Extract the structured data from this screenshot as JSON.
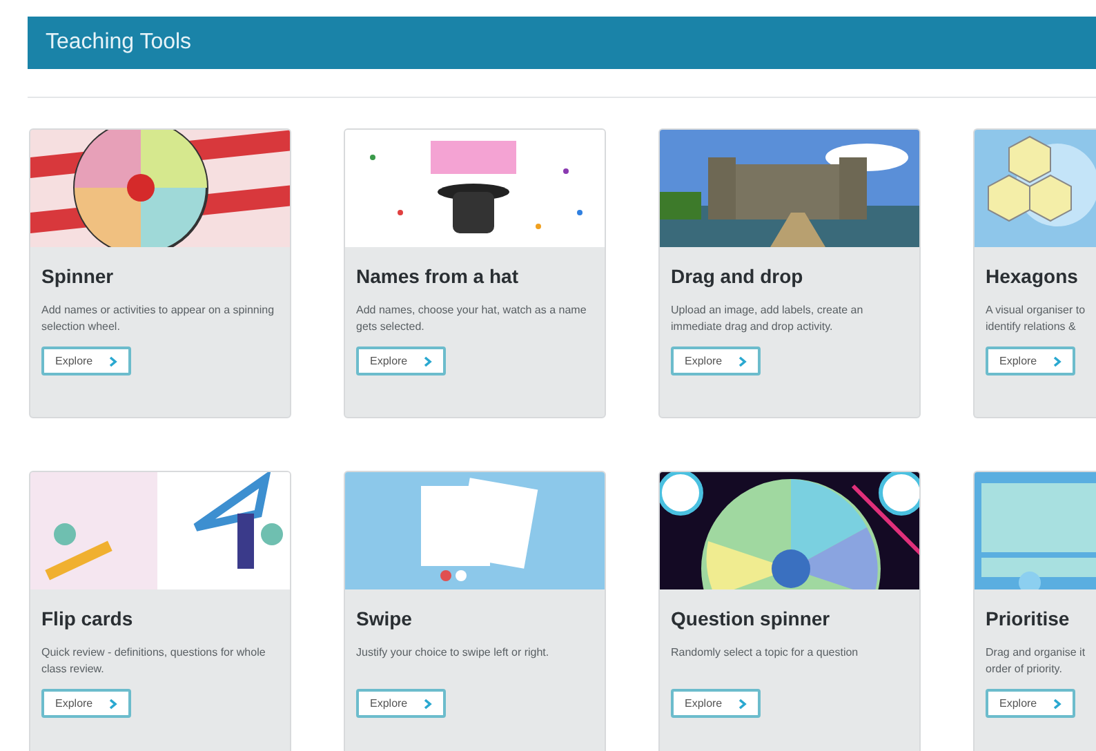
{
  "header": {
    "title": "Teaching Tools"
  },
  "tools": [
    {
      "title": "Spinner",
      "description": "Add names or activities to appear on a spinning selection wheel.",
      "button": "Explore"
    },
    {
      "title": "Names from a hat",
      "description": "Add names, choose your hat, watch as a name gets selected.",
      "button": "Explore"
    },
    {
      "title": "Drag and drop",
      "description": "Upload an image, add labels, create an immediate drag and drop activity.",
      "button": "Explore"
    },
    {
      "title": "Hexagons",
      "description": "A visual organiser to identify relations &",
      "button": "Explore"
    },
    {
      "title": "Flip cards",
      "description": "Quick review - definitions, questions for whole class review.",
      "button": "Explore"
    },
    {
      "title": "Swipe",
      "description": "Justify your choice to swipe left or right.",
      "button": "Explore"
    },
    {
      "title": "Question spinner",
      "description": "Randomly select a topic for a question",
      "button": "Explore"
    },
    {
      "title": "Prioritise",
      "description": "Drag and organise it order of priority.",
      "button": "Explore"
    }
  ]
}
